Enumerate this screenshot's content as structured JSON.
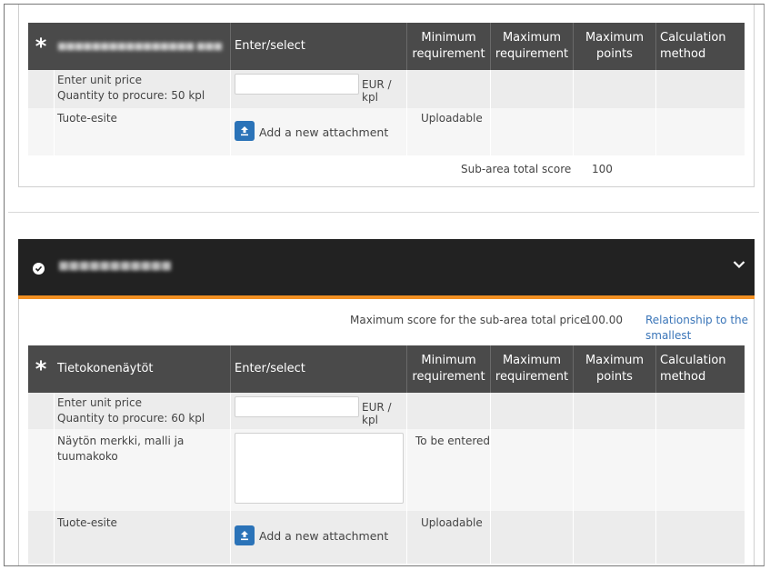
{
  "top_link": {
    "text": "smallest"
  },
  "table1": {
    "headers": {
      "star": "*",
      "name_blurred": "■■■■■■■■■■■■■■■■ ■■■",
      "enter_select": "Enter/select",
      "min_req": "Minimum requirement",
      "max_req": "Maximum requirement",
      "max_points": "Maximum points",
      "calc_method": "Calculation method"
    },
    "rows": [
      {
        "label1": "Enter unit price",
        "label2": "Quantity to procure: 50 kpl",
        "input_value": "",
        "unit": "EUR / kpl"
      },
      {
        "label1": "Tuote-esite",
        "attach_label": "Add a new attachment",
        "min_req": "Uploadable"
      }
    ],
    "subtotal_label": "Sub-area total score",
    "subtotal_value": "100"
  },
  "section2": {
    "title_blurred": "■■■■■■■■■■■",
    "max_score_label": "Maximum score for the sub-area total price",
    "max_score_value": "100.00",
    "relationship_link_line1": "Relationship to the",
    "relationship_link_line2": "smallest"
  },
  "table2": {
    "headers": {
      "star": "*",
      "name": "Tietokonenäytöt",
      "enter_select": "Enter/select",
      "min_req": "Minimum requirement",
      "max_req": "Maximum requirement",
      "max_points": "Maximum points",
      "calc_method": "Calculation method"
    },
    "rows": [
      {
        "label1": "Enter unit price",
        "label2": "Quantity to procure: 60 kpl",
        "input_value": "",
        "unit": "EUR / kpl"
      },
      {
        "label1": "Näytön merkki, malli ja tuumakoko",
        "textarea_value": "",
        "min_req": "To be entered"
      },
      {
        "label1": "Tuote-esite",
        "attach_label": "Add a new attachment",
        "min_req": "Uploadable"
      }
    ]
  },
  "colors": {
    "header_bg": "#4a4a4a",
    "section_header_bg": "#222222",
    "accent_orange": "#f29022",
    "link_blue": "#3a75b8",
    "upload_button_blue": "#2b73b8"
  },
  "icons": {
    "required": "asterisk-icon",
    "upload": "upload-icon",
    "section_status": "check-circle-icon",
    "collapse": "chevron-down-icon"
  }
}
